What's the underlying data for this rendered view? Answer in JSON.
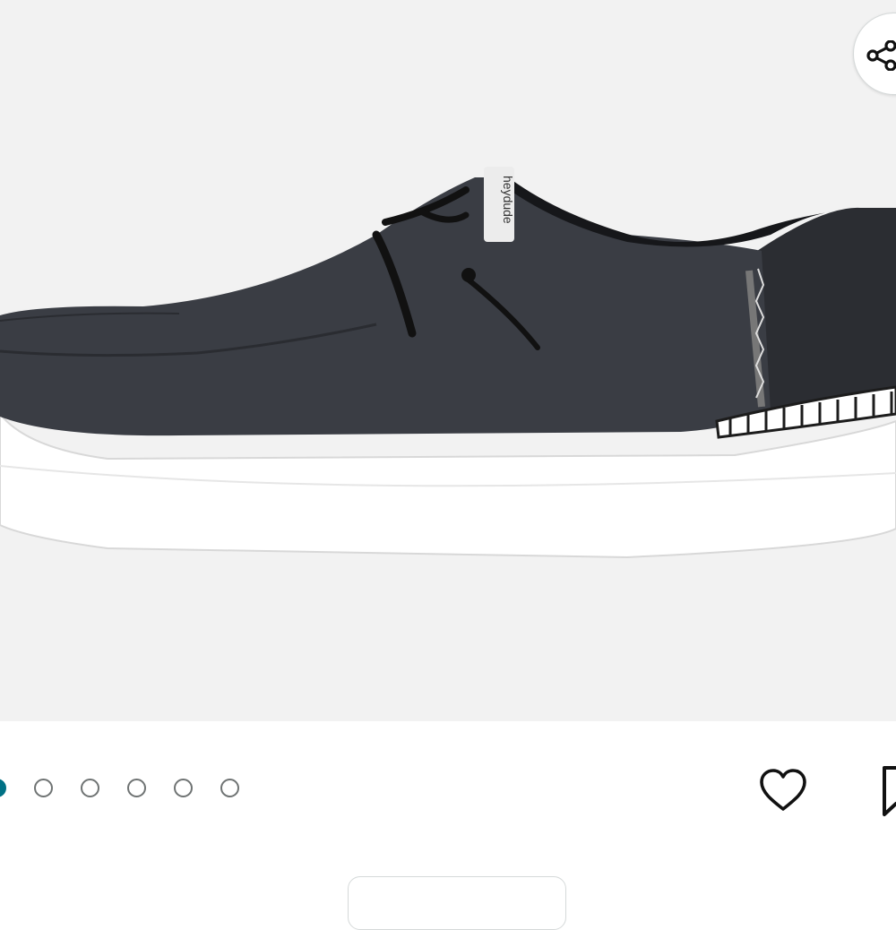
{
  "product_image": {
    "alt": "",
    "tag_text": "heydude",
    "colors": {
      "background": "#f2f2f2",
      "upper": "#3a3d44",
      "heel": "#2b2d32",
      "sole": "#ffffff",
      "stitch": "#1c1c1c"
    }
  },
  "share": {
    "icon": "share-icon"
  },
  "carousel": {
    "total": 6,
    "active_index": 0,
    "accent_color": "#007185"
  },
  "actions": {
    "like_icon": "heart-icon",
    "save_icon": "bookmark-icon"
  }
}
